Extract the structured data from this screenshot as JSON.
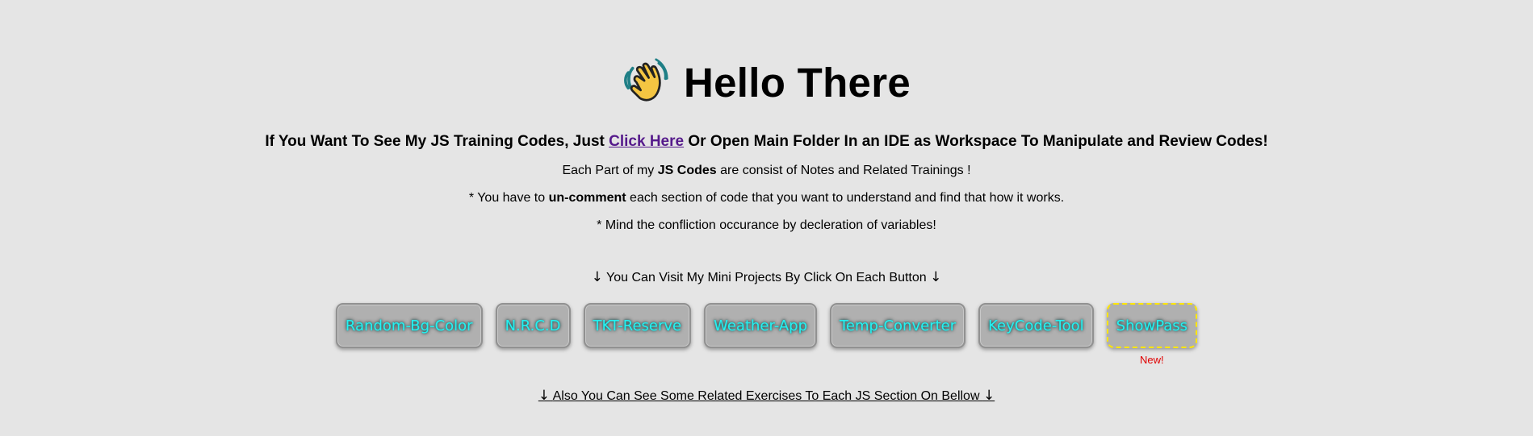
{
  "header": {
    "icon": "waving-hand-icon",
    "title": "Hello There"
  },
  "intro": {
    "prefix": "If You Want To See My JS Training Codes, Just ",
    "link_label": "Click Here",
    "suffix": " Or Open Main Folder In an IDE as Workspace To Manipulate and Review Codes!"
  },
  "notes": {
    "line1_prefix": "Each Part of my ",
    "line1_bold": "JS Codes",
    "line1_suffix": " are consist of Notes and Related Trainings !",
    "line2_prefix": "* You have to ",
    "line2_bold": "un-comment",
    "line2_suffix": " each section of code that you want to understand and find that how it works.",
    "line3": "* Mind the confliction occurance by decleration of variables!",
    "projects_heading_text": "You Can Visit My Mini Projects By Click On Each Button"
  },
  "projects": [
    {
      "label": "Random-Bg-Color",
      "new": false
    },
    {
      "label": "N.R.C.D",
      "new": false
    },
    {
      "label": "TKT-Reserve",
      "new": false
    },
    {
      "label": "Weather-App",
      "new": false
    },
    {
      "label": "Temp-Converter",
      "new": false
    },
    {
      "label": "KeyCode-Tool",
      "new": false
    },
    {
      "label": "ShowPass",
      "new": true,
      "badge": "New!"
    }
  ],
  "bottom": {
    "text": "Also You Can See Some Related Exercises To Each JS Section On Bellow"
  },
  "colors": {
    "background": "#e5e5e5",
    "button_text": "#25f1f1",
    "link": "#551a8b",
    "new_border": "#ffe600",
    "new_badge": "#e00000"
  }
}
